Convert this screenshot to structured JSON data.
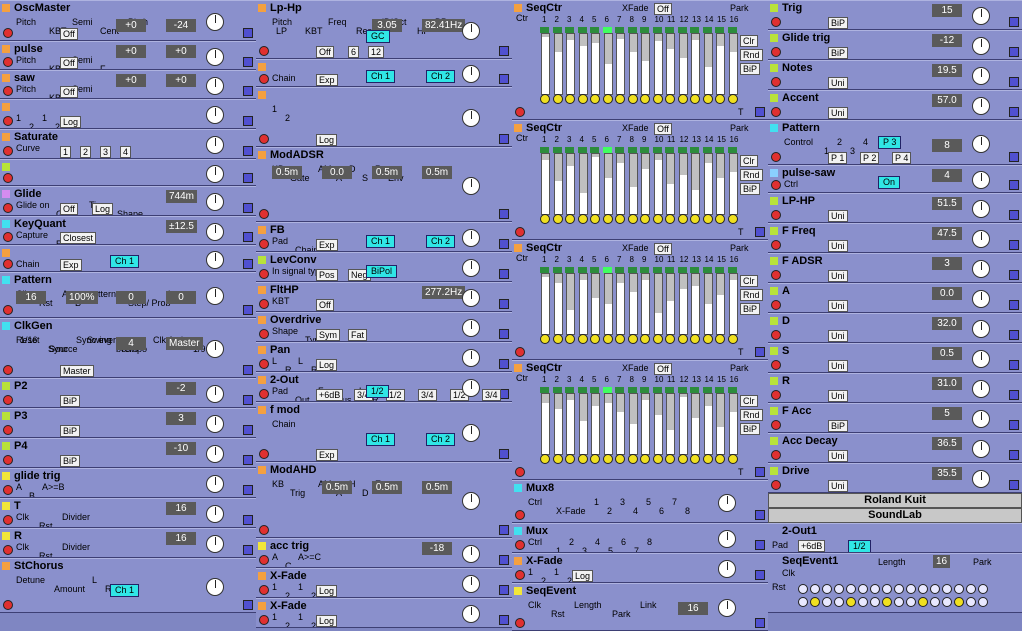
{
  "columns": {
    "col1": [
      {
        "id": "oscmaster",
        "title": "OscMaster",
        "h": 41,
        "tri": "o",
        "labels": [
          "Pitch",
          "KBT",
          "Semi",
          "Cent",
          "Pitch"
        ],
        "buttons": [
          "Off"
        ],
        "numbers": [
          "-24",
          "+0"
        ]
      },
      {
        "id": "pulse",
        "title": "pulse",
        "h": 29,
        "tri": "o",
        "labels": [
          "Pitch",
          "KBT",
          "Semi",
          "F"
        ],
        "buttons": [
          "Off"
        ],
        "numbers": [
          "+0",
          "+0"
        ]
      },
      {
        "id": "saw",
        "title": "saw",
        "h": 29,
        "tri": "o",
        "labels": [
          "Pitch",
          "KBT",
          "Semi"
        ],
        "buttons": [
          "Off"
        ],
        "numbers": [
          "+0",
          "+0"
        ]
      },
      {
        "id": "mixlog1",
        "title": "",
        "h": 30,
        "tri": "o",
        "labels": [
          "1",
          "2",
          "1",
          "2"
        ],
        "buttons": [
          "Log"
        ]
      },
      {
        "id": "saturate",
        "title": "Saturate",
        "h": 30,
        "tri": "o",
        "labels": [
          "Curve"
        ],
        "buttons": [
          "1",
          "2",
          "3",
          "4"
        ]
      },
      {
        "id": "blank1",
        "title": "",
        "h": 27,
        "tri": "g",
        "labels": [],
        "buttons": []
      },
      {
        "id": "glide",
        "title": "Glide",
        "h": 30,
        "tri": "v",
        "labels": [
          "Glide on",
          "Glide",
          "Time",
          "Shape"
        ],
        "buttons": [
          "Off",
          "Log"
        ],
        "numbers": [
          "744m"
        ]
      },
      {
        "id": "keyquant",
        "title": "KeyQuant",
        "h": 29,
        "tri": "c",
        "labels": [
          "Capture",
          "Range"
        ],
        "buttons": [
          "Closest"
        ],
        "numbers": [
          "±12.5"
        ]
      },
      {
        "id": "chainexp1",
        "title": "",
        "h": 27,
        "tri": "o",
        "labels": [
          "Chain"
        ],
        "buttons": [
          "Exp"
        ],
        "cyans": [
          "Ch 1"
        ]
      },
      {
        "id": "pattern",
        "title": "Pattern",
        "h": 46,
        "tri": "c",
        "labels": [
          "Clk",
          "Rst",
          "A",
          "B",
          "pattern",
          "Step/ Prob",
          "Loop"
        ],
        "numbers": [
          "0",
          "0",
          "100%",
          "16"
        ]
      },
      {
        "id": "clkgen",
        "title": "ClkGen",
        "h": 60,
        "tri": "c",
        "labels": [
          "Reset",
          "Source",
          "Swing",
          "Tempo",
          "Clk Active",
          "1/96",
          "1/16",
          "Sync",
          "Sync every",
          "beats"
        ],
        "buttons": [
          "Master"
        ],
        "numbers": [
          "Master",
          "4"
        ]
      },
      {
        "id": "p2",
        "title": "P2",
        "h": 30,
        "tri": "g",
        "buttons": [
          "BiP"
        ],
        "numbers": [
          "-2"
        ]
      },
      {
        "id": "p3",
        "title": "P3",
        "h": 30,
        "tri": "g",
        "buttons": [
          "BiP"
        ],
        "numbers": [
          "3"
        ]
      },
      {
        "id": "p4",
        "title": "P4",
        "h": 30,
        "tri": "g",
        "buttons": [
          "BiP"
        ],
        "numbers": [
          "-10"
        ]
      },
      {
        "id": "glidetrig",
        "title": "glide trig",
        "h": 30,
        "tri": "y",
        "labels": [
          "A",
          "B",
          "A>=B"
        ]
      },
      {
        "id": "t",
        "title": "T",
        "h": 30,
        "tri": "y",
        "labels": [
          "Clk",
          "Rst",
          "Divider"
        ],
        "numbers": [
          "16"
        ]
      },
      {
        "id": "r",
        "title": "R",
        "h": 30,
        "tri": "y",
        "labels": [
          "Clk",
          "Rst",
          "Divider"
        ],
        "numbers": [
          "16"
        ]
      },
      {
        "id": "stchorus",
        "title": "StChorus",
        "h": 55,
        "tri": "o",
        "labels": [
          "Detune",
          "Amount",
          "L",
          "R"
        ],
        "cyans": [
          "Ch 1"
        ]
      }
    ],
    "col2": [
      {
        "id": "lphp",
        "title": "Lp-Hp",
        "h": 59,
        "tri": "o",
        "labels": [
          "Pitch",
          "KBT",
          "Freq",
          "Res",
          "dB/Oct",
          "HP",
          "BP",
          "LP"
        ],
        "buttons": [
          "Off",
          "6",
          "12"
        ],
        "numbers": [
          "82.41Hz",
          "3.05"
        ],
        "cyans": [
          "GC"
        ]
      },
      {
        "id": "chainexp2",
        "title": "",
        "h": 28,
        "tri": "o",
        "labels": [
          "Chain"
        ],
        "buttons": [
          "Exp"
        ],
        "cyans": [
          "Ch 1",
          "Ch 2"
        ]
      },
      {
        "id": "mixlog2",
        "title": "",
        "h": 60,
        "tri": "o",
        "labels": [
          "1",
          "2"
        ],
        "buttons": [
          "Log"
        ]
      },
      {
        "id": "modadsr",
        "title": "ModADSR",
        "h": 75,
        "tri": "o",
        "labels": [
          "KB",
          "Gate",
          "AM",
          "A",
          "D",
          "S",
          "R",
          "Env"
        ],
        "numbers": [
          "0.5m",
          "0.5m",
          "0.0",
          "0.5m"
        ]
      },
      {
        "id": "fb",
        "title": "FB",
        "h": 30,
        "tri": "o",
        "labels": [
          "Pad",
          "Chain"
        ],
        "buttons": [
          "Exp"
        ],
        "cyans": [
          "Ch 1",
          "Ch 2"
        ]
      },
      {
        "id": "levconv",
        "title": "LevConv",
        "h": 30,
        "tri": "g",
        "labels": [
          "In signal type"
        ],
        "buttons": [
          "Pos",
          "Neg"
        ],
        "cyans": [
          "BiPol"
        ]
      },
      {
        "id": "flthp",
        "title": "FltHP",
        "h": 30,
        "tri": "o",
        "labels": [
          "KBT"
        ],
        "buttons": [
          "Off"
        ],
        "numbers": [
          "277.2Hz"
        ]
      },
      {
        "id": "overdrive",
        "title": "Overdrive",
        "h": 30,
        "tri": "o",
        "labels": [
          "Shape",
          "Type"
        ],
        "buttons": [
          "Sym",
          "Fat"
        ]
      },
      {
        "id": "pan",
        "title": "Pan",
        "h": 30,
        "tri": "o",
        "labels": [
          "L",
          "R",
          "L",
          "R"
        ],
        "buttons": [
          "Log"
        ]
      },
      {
        "id": "twoout",
        "title": "2-Out",
        "h": 30,
        "tri": "o",
        "labels": [
          "Pad",
          "Out",
          "Fx",
          "Bus",
          "L",
          "R"
        ],
        "buttons": [
          "+6dB",
          "3/4",
          "1/2",
          "3/4",
          "1/2",
          "3/4"
        ],
        "cyans": [
          "1/2"
        ]
      },
      {
        "id": "fmod",
        "title": "f mod",
        "h": 60,
        "tri": "o",
        "labels": [
          "Chain"
        ],
        "buttons": [
          "Exp"
        ],
        "cyans": [
          "Ch 1",
          "Ch 2"
        ]
      },
      {
        "id": "modahd",
        "title": "ModAHD",
        "h": 76,
        "tri": "o",
        "labels": [
          "KB",
          "Trig",
          "AM",
          "A",
          "H",
          "D",
          "Env"
        ],
        "numbers": [
          "0.5m",
          "0.5m",
          "0.5m"
        ]
      },
      {
        "id": "acctrig",
        "title": "acc trig",
        "h": 30,
        "tri": "y",
        "labels": [
          "A",
          "C",
          "A>=C"
        ],
        "numbers": [
          "-18"
        ]
      },
      {
        "id": "xfade1",
        "title": "X-Fade",
        "h": 30,
        "tri": "o",
        "labels": [
          "1",
          "2",
          "1",
          "2"
        ],
        "buttons": [
          "Log"
        ]
      },
      {
        "id": "xfade2",
        "title": "X-Fade",
        "h": 30,
        "tri": "o",
        "labels": [
          "1",
          "2",
          "1",
          "2"
        ],
        "buttons": [
          "Log"
        ]
      }
    ],
    "col3": [
      {
        "id": "seqctr1",
        "title": "SeqCtr",
        "h": 120,
        "tri": "o",
        "xfade": "Off",
        "labels": [
          "Ctr",
          "XFade",
          "Park",
          "T"
        ],
        "buttons": [
          "Clr",
          "Rnd",
          "BiP"
        ]
      },
      {
        "id": "seqctr2",
        "title": "SeqCtr",
        "h": 120,
        "tri": "o",
        "xfade": "Off",
        "labels": [
          "Ctr",
          "XFade",
          "Park",
          "T"
        ],
        "buttons": [
          "Clr",
          "Rnd",
          "BiP"
        ]
      },
      {
        "id": "seqctr3",
        "title": "SeqCtr",
        "h": 120,
        "tri": "o",
        "xfade": "Off",
        "labels": [
          "Ctr",
          "XFade",
          "Park",
          "T"
        ],
        "buttons": [
          "Clr",
          "Rnd",
          "BiP"
        ]
      },
      {
        "id": "seqctr4",
        "title": "SeqCtr",
        "h": 120,
        "tri": "o",
        "xfade": "Off",
        "labels": [
          "Ctr",
          "XFade",
          "Park",
          "T"
        ],
        "buttons": [
          "Clr",
          "Rnd",
          "BiP"
        ]
      },
      {
        "id": "mux8",
        "title": "Mux8",
        "h": 43,
        "tri": "c",
        "labels": [
          "Ctrl",
          "X-Fade",
          "1",
          "2",
          "3",
          "4",
          "5",
          "6",
          "7",
          "8"
        ]
      },
      {
        "id": "mux",
        "title": "Mux",
        "h": 30,
        "tri": "c",
        "labels": [
          "Ctrl",
          "1",
          "2",
          "3",
          "4",
          "5",
          "6",
          "7",
          "8"
        ]
      },
      {
        "id": "xfade3",
        "title": "X-Fade",
        "h": 30,
        "tri": "o",
        "labels": [
          "1",
          "2",
          "1",
          "2"
        ],
        "buttons": [
          "Log"
        ]
      },
      {
        "id": "seqevent",
        "title": "SeqEvent",
        "h": 48,
        "tri": "y",
        "labels": [
          "Clk",
          "Rst",
          "Length",
          "Park",
          "Link"
        ],
        "numbers": [
          "16"
        ]
      }
    ],
    "col4": [
      {
        "id": "trig",
        "title": "Trig",
        "h": 30,
        "tri": "g",
        "buttons": [
          "BiP"
        ],
        "numbers": [
          "15"
        ]
      },
      {
        "id": "glidetrig2",
        "title": "Glide trig",
        "h": 30,
        "tri": "g",
        "buttons": [
          "BiP"
        ],
        "numbers": [
          "-12"
        ]
      },
      {
        "id": "notes",
        "title": "Notes",
        "h": 30,
        "tri": "g",
        "buttons": [
          "Uni"
        ],
        "numbers": [
          "19.5"
        ]
      },
      {
        "id": "accent",
        "title": "Accent",
        "h": 30,
        "tri": "g",
        "buttons": [
          "Uni"
        ],
        "numbers": [
          "57.0"
        ]
      },
      {
        "id": "pattern2",
        "title": "Pattern",
        "h": 45,
        "tri": "c",
        "labels": [
          "Control",
          "1",
          "2",
          "3",
          "4"
        ],
        "buttons": [
          "P 1",
          "P 2",
          "P 4"
        ],
        "numbers": [
          "8"
        ],
        "cyans": [
          "P 3"
        ]
      },
      {
        "id": "pulsesaw",
        "title": "pulse-saw",
        "h": 28,
        "tri": "s",
        "labels": [
          "Ctrl"
        ],
        "numbers": [
          "4"
        ],
        "cyans": [
          "On"
        ]
      },
      {
        "id": "lphp2",
        "title": "LP-HP",
        "h": 30,
        "tri": "g",
        "buttons": [
          "Uni"
        ],
        "numbers": [
          "51.5"
        ]
      },
      {
        "id": "ffreq",
        "title": "F Freq",
        "h": 30,
        "tri": "g",
        "buttons": [
          "Uni"
        ],
        "numbers": [
          "47.5"
        ]
      },
      {
        "id": "fadsr",
        "title": "F ADSR",
        "h": 30,
        "tri": "g",
        "buttons": [
          "Uni"
        ],
        "numbers": [
          "3"
        ]
      },
      {
        "id": "a",
        "title": "A",
        "h": 30,
        "tri": "g",
        "buttons": [
          "Uni"
        ],
        "numbers": [
          "0.0"
        ]
      },
      {
        "id": "d",
        "title": "D",
        "h": 30,
        "tri": "g",
        "buttons": [
          "Uni"
        ],
        "numbers": [
          "32.0"
        ]
      },
      {
        "id": "s",
        "title": "S",
        "h": 30,
        "tri": "g",
        "buttons": [
          "Uni"
        ],
        "numbers": [
          "0.5"
        ]
      },
      {
        "id": "rr",
        "title": "R",
        "h": 30,
        "tri": "g",
        "buttons": [
          "Uni"
        ],
        "numbers": [
          "31.0"
        ]
      },
      {
        "id": "facc",
        "title": "F Acc",
        "h": 30,
        "tri": "g",
        "buttons": [
          "BiP"
        ],
        "numbers": [
          "5"
        ]
      },
      {
        "id": "accdecay",
        "title": "Acc Decay",
        "h": 30,
        "tri": "g",
        "buttons": [
          "Uni"
        ],
        "numbers": [
          "36.5"
        ]
      },
      {
        "id": "drive",
        "title": "Drive",
        "h": 30,
        "tri": "g",
        "buttons": [
          "Uni"
        ],
        "numbers": [
          "35.5"
        ]
      }
    ]
  },
  "footer": {
    "brand1": "Roland Kuit",
    "brand2": "SoundLab",
    "out1": {
      "title": "2-Out1",
      "labels": [
        "Pad",
        "Out",
        "Fx",
        "Bus",
        "L",
        "R"
      ],
      "buttons": [
        "+6dB",
        "3/4",
        "1/2",
        "3/4",
        "1/2",
        "3/4"
      ],
      "cyans": [
        "1/2"
      ]
    },
    "seqevent1": {
      "title": "SeqEvent1",
      "labels": [
        "Clk",
        "Rst",
        "Length",
        "Park",
        "Link",
        "Lp",
        "T"
      ],
      "numbers": [
        "16"
      ]
    }
  },
  "seq_steps": [
    "1",
    "2",
    "3",
    "4",
    "5",
    "6",
    "7",
    "8",
    "9",
    "10",
    "11",
    "12",
    "13",
    "14",
    "15",
    "16"
  ],
  "seq_levels": [
    [
      0.95,
      0.7,
      0.9,
      0.8,
      0.85,
      0.5,
      0.92,
      0.7,
      0.55,
      0.88,
      0.75,
      0.6,
      0.9,
      0.45,
      0.8,
      0.7
    ],
    [
      0.9,
      0.55,
      0.8,
      0.35,
      0.95,
      0.6,
      0.85,
      0.45,
      0.75,
      0.9,
      0.5,
      0.65,
      0.4,
      0.85,
      0.6,
      0.7
    ],
    [
      0.95,
      0.85,
      0.4,
      0.9,
      0.6,
      0.5,
      0.85,
      0.7,
      0.9,
      0.35,
      0.55,
      0.75,
      0.8,
      0.5,
      0.65,
      0.9
    ],
    [
      0.85,
      0.75,
      0.9,
      0.55,
      0.8,
      0.85,
      0.7,
      0.5,
      0.9,
      0.65,
      0.4,
      0.95,
      0.6,
      0.8,
      0.45,
      0.7
    ]
  ],
  "seq_active_step": 6,
  "colors": {
    "rack_bg": "#7f86c2",
    "module_bg": "#8a90cc",
    "cyan": "#30e6e6",
    "display": "#1ca88a",
    "jack_red": "#e03030",
    "jack_blue": "#5050d0",
    "jack_yellow": "#f0e020"
  }
}
